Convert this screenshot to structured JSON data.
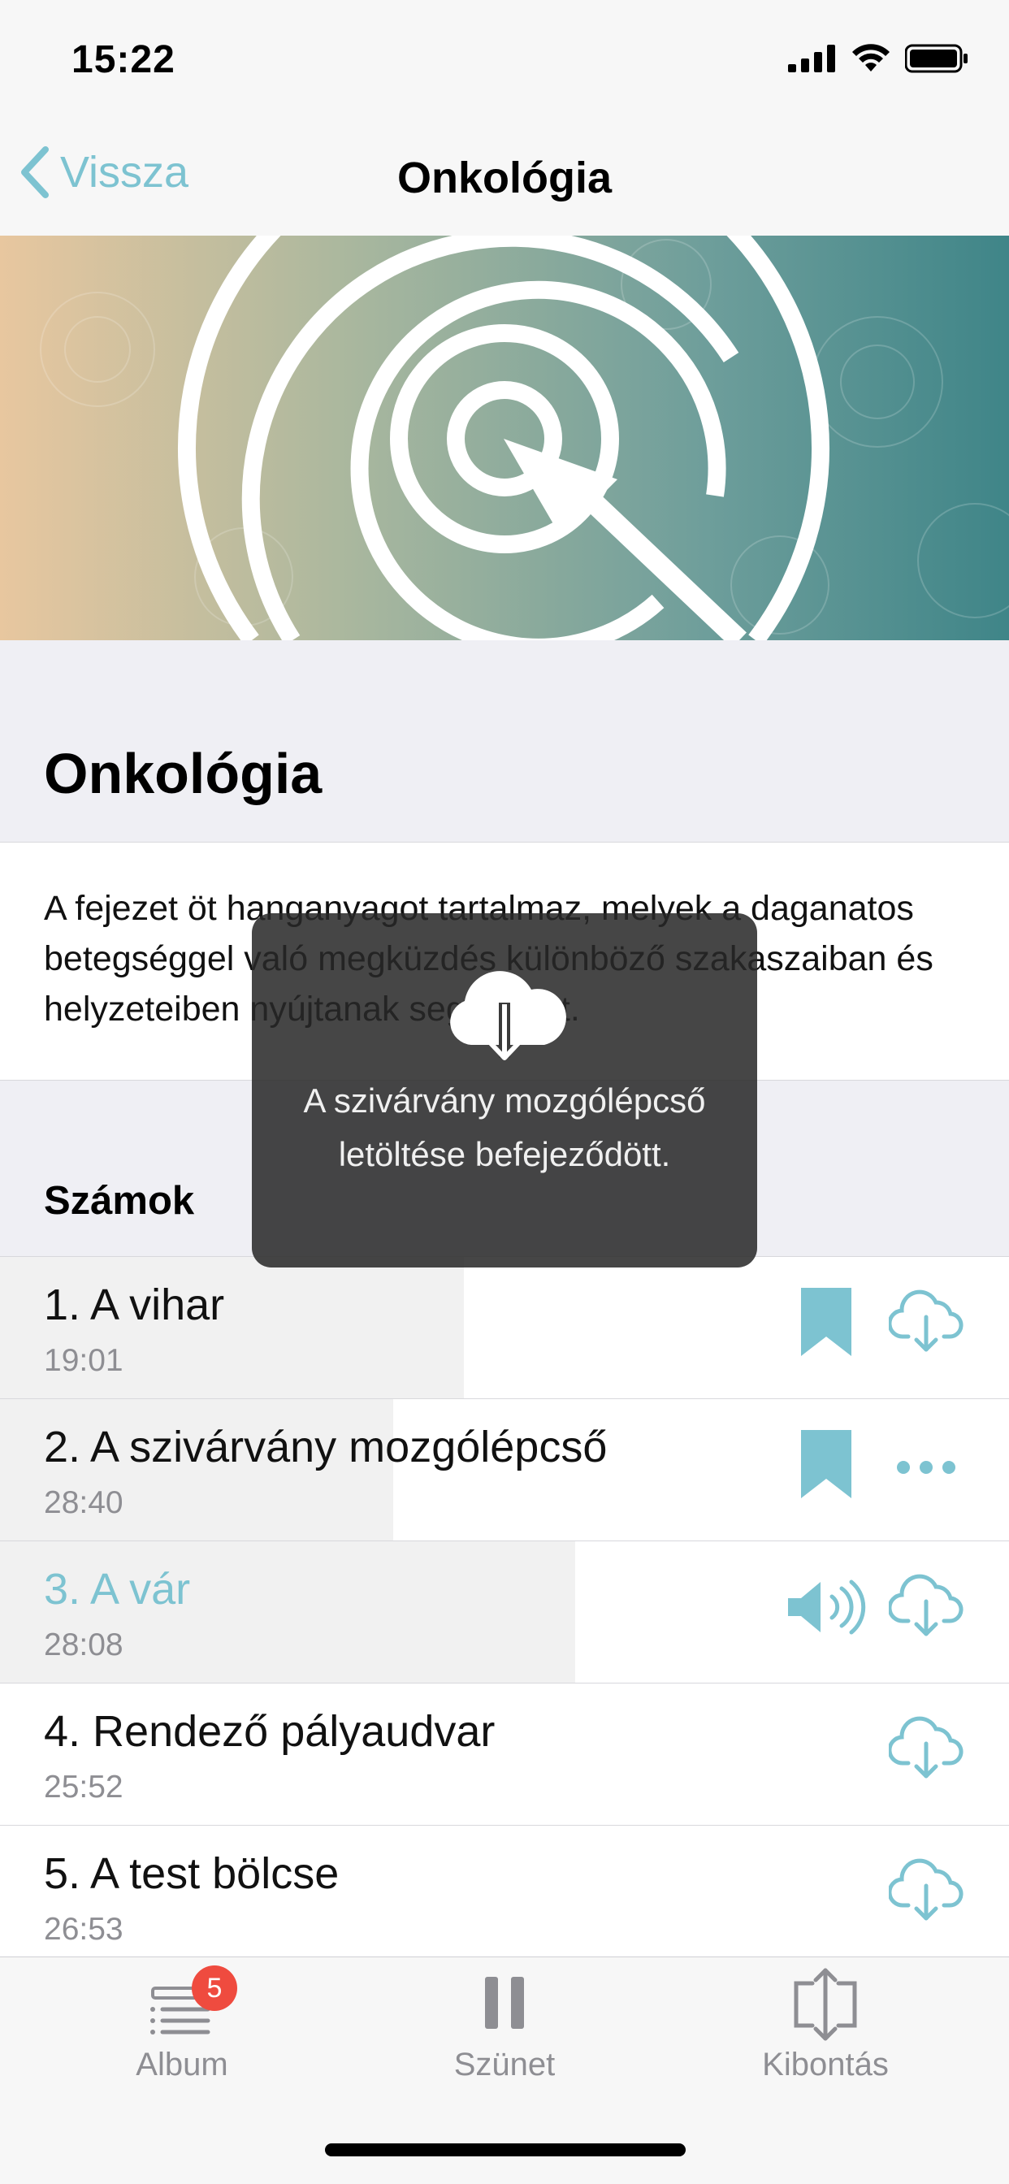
{
  "status_bar": {
    "time": "15:22"
  },
  "nav": {
    "back_label": "Vissza",
    "title": "Onkológia"
  },
  "section": {
    "title": "Onkológia",
    "description": "A fejezet öt hanganyagot tartalmaz, melyek a daganatos betegséggel való megküzdés különböző szakaszaiban és helyzeteiben nyújtanak segítséget."
  },
  "tracks_header": "Számok",
  "tracks": [
    {
      "title": "1. A vihar",
      "duration": "19:01",
      "progress": 0.46,
      "bookmarked": true,
      "action": "download"
    },
    {
      "title": "2. A szivárvány mozgólépcső",
      "duration": "28:40",
      "progress": 0.39,
      "bookmarked": true,
      "action": "more"
    },
    {
      "title": "3. A vár",
      "duration": "28:08",
      "progress": 0.57,
      "playing": true,
      "action": "download"
    },
    {
      "title": "4. Rendező pályaudvar",
      "duration": "25:52",
      "progress": 0,
      "action": "download"
    },
    {
      "title": "5. A test bölcse",
      "duration": "26:53",
      "progress": 0,
      "action": "download"
    }
  ],
  "toast": {
    "message": "A szivárvány mozgólépcső letöltése befejeződött.",
    "icon": "cloud-download-icon"
  },
  "tabbar": {
    "album_label": "Album",
    "album_badge": "5",
    "pause_label": "Szünet",
    "expand_label": "Kibontás"
  },
  "colors": {
    "accent": "#7dc3d1",
    "badge": "#ef4b3f",
    "background": "#efeff4"
  }
}
